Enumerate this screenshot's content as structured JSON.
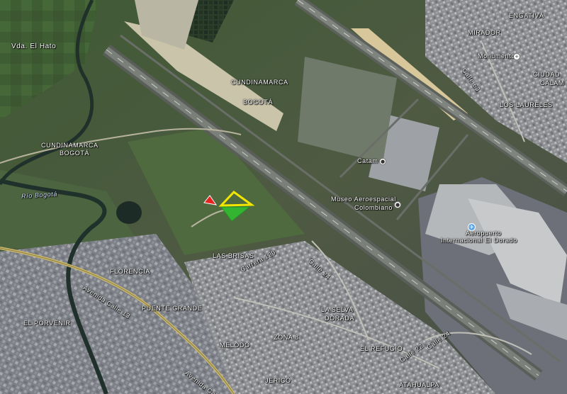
{
  "map": {
    "labels": {
      "vda_el_hato": "Vda. El Hato",
      "cundinamarca_top": "CUNDINAMARCA",
      "bogota_top": "BOGOTÁ",
      "cundinamarca_left": "CUNDINAMARCA",
      "bogota_left": "BOGOTÁ",
      "rio_bogota": "Río Bogotá",
      "engativa": "ENGATIVÁ",
      "mirador": "MIRADOR",
      "monumento": "Monumento",
      "calle_63": "Calle 63",
      "ciudadela_calamar": "CIUDAD",
      "calamar": "CALAM",
      "los_laureles": "LOS LAURELES",
      "catam": "Catam",
      "museo_line1": "Museo Aeroespacial",
      "museo_line2": "Colombiano",
      "aeropuerto_line1": "Aeropuerto",
      "aeropuerto_line2": "Internacional El Dorado",
      "las_brisas": "LAS BRISAS",
      "florencia": "FLORENCIA",
      "puente_grande": "PUENTE GRANDE",
      "el_porvenir": "EL PORVENIR",
      "la_selva_dorada_1": "LA SELVA",
      "la_selva_dorada_2": "DORADA",
      "melodo": "MELODO",
      "zona_8": "ZONA 8",
      "el_refugio": "EL REFUGIO",
      "jerico": "JERICÓ",
      "atahualpa": "ATAHUALPA",
      "avenida_calle_13_a": "Avenida Calle 13",
      "avenida_calle_13_b": "Avenida Calle 13",
      "calle_24": "Calle 24",
      "calle_24_b": "Calle 24",
      "carrera_129": "Carrera 129",
      "calle_22": "Calle 22",
      "calle_24c": "Calle 24"
    },
    "markers": {
      "red": {
        "color": "#e8231f"
      },
      "yellow": {
        "color": "#f2e600"
      },
      "green": {
        "color": "#34b531"
      }
    },
    "icons": {
      "poi": "poi-icon",
      "airport": "airplane-icon"
    }
  }
}
